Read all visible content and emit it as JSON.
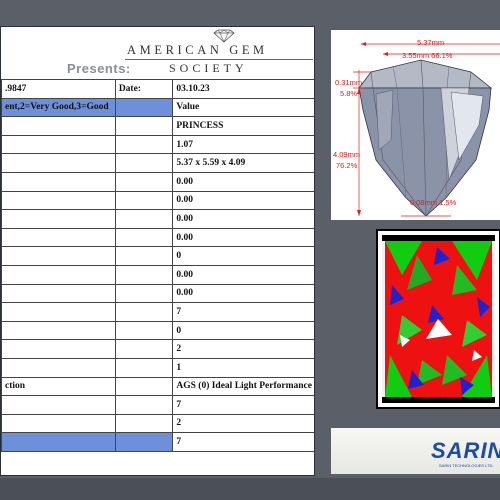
{
  "header": {
    "presents": "Presents:",
    "logo_line1": "AMERICAN GEM",
    "logo_line2": "SOCIETY"
  },
  "report": {
    "rows": [
      {
        "c1": ".9847",
        "c2": "Date:",
        "c3": "03.10.23",
        "hl": false
      },
      {
        "c1": "ent,2=Very Good,3=Good",
        "c2": "",
        "c3": "Value",
        "hl": true
      },
      {
        "c1": "",
        "c2": "",
        "c3": "PRINCESS",
        "hl": false
      },
      {
        "c1": "",
        "c2": "",
        "c3": "1.07",
        "hl": false
      },
      {
        "c1": "",
        "c2": "",
        "c3": "5.37 x 5.59 x 4.09",
        "hl": false
      },
      {
        "c1": "",
        "c2": "",
        "c3": "0.00",
        "hl": false
      },
      {
        "c1": "",
        "c2": "",
        "c3": "0.00",
        "hl": false
      },
      {
        "c1": "",
        "c2": "",
        "c3": "0.00",
        "hl": false
      },
      {
        "c1": "",
        "c2": "",
        "c3": "0.00",
        "hl": false
      },
      {
        "c1": "",
        "c2": "",
        "c3": "0",
        "hl": false
      },
      {
        "c1": "",
        "c2": "",
        "c3": "0.00",
        "hl": false
      },
      {
        "c1": "",
        "c2": "",
        "c3": "0.00",
        "hl": false
      },
      {
        "c1": "",
        "c2": "",
        "c3": "7",
        "hl": false
      },
      {
        "c1": "",
        "c2": "",
        "c3": "0",
        "hl": false
      },
      {
        "c1": "",
        "c2": "",
        "c3": "2",
        "hl": false
      },
      {
        "c1": "",
        "c2": "",
        "c3": "1",
        "hl": false
      },
      {
        "c1": "ction",
        "c2": "",
        "c3": "AGS (0) Ideal Light Performance",
        "hl": false
      },
      {
        "c1": "",
        "c2": "",
        "c3": "7",
        "hl": false
      },
      {
        "c1": "",
        "c2": "",
        "c3": "2",
        "hl": false
      },
      {
        "c1": "",
        "c2": "",
        "c3": "7",
        "hl": true
      }
    ]
  },
  "diagram": {
    "width_label": "5.37mm",
    "table_label": "3.55mm 66.1%",
    "crown_mm": "0.31mm",
    "crown_pct": "5.8%",
    "depth_mm": "4.09mm",
    "depth_pct": "76.2%",
    "culet_label": "0.08mm 1.5%"
  },
  "brand": {
    "sarin": "SARIN",
    "sarin_sub": "SARIN TECHNOLOGIES LTD."
  },
  "colors": {
    "highlight": "#6e8fd9",
    "dim_red": "#d42020",
    "sarin_blue": "#1d4aa2"
  }
}
